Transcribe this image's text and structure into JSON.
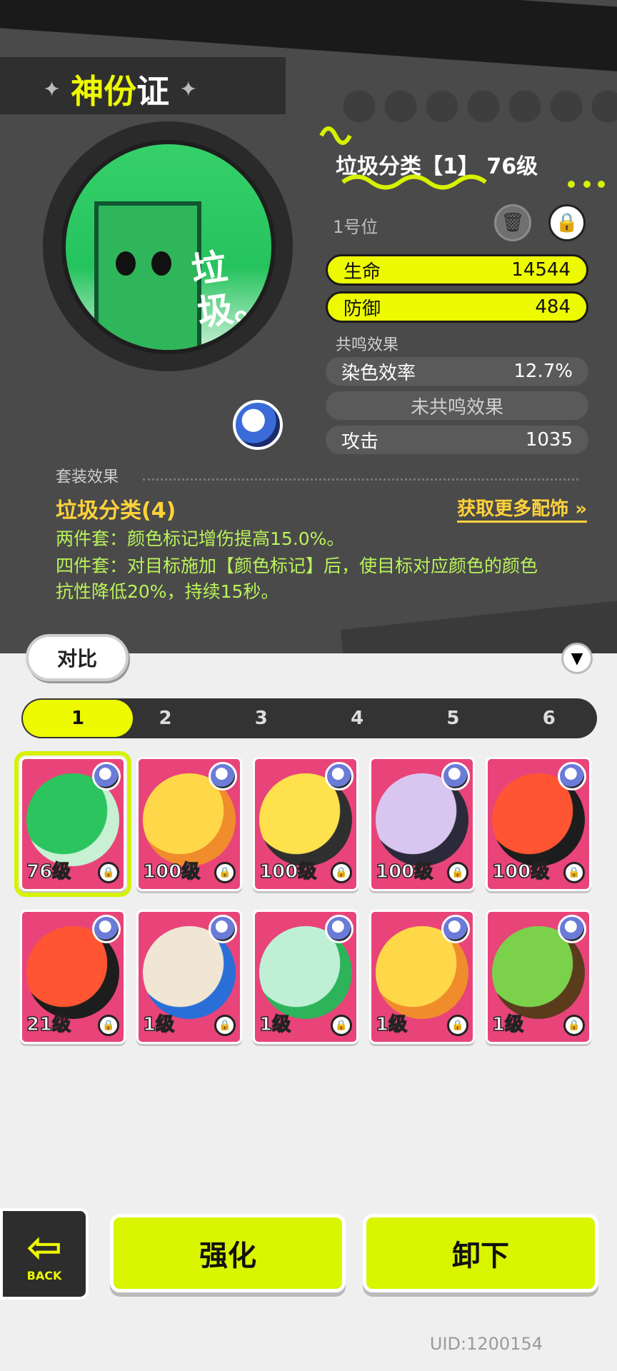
{
  "header": {
    "title_a": "神份",
    "title_b": "证"
  },
  "item": {
    "name": "垃圾分类【1】 76级",
    "slot": "1号位",
    "main_stats": [
      {
        "label": "生命",
        "value": "14544"
      },
      {
        "label": "防御",
        "value": "484"
      }
    ],
    "resonance_title": "共鸣效果",
    "sub_stats": [
      {
        "label": "染色效率",
        "value": "12.7%"
      },
      {
        "label": "未共鸣效果",
        "value": ""
      },
      {
        "label": "攻击",
        "value": "1035"
      }
    ],
    "emblem_text": "垃圾。"
  },
  "suit": {
    "label": "套装效果",
    "title": "垃圾分类(4)",
    "get_more": "获取更多配饰 »",
    "effect_2": "两件套：颜色标记增伤提高15.0%。",
    "effect_4_line1": "四件套：对目标施加【颜色标记】后，使目标对应颜色的颜色",
    "effect_4_line2": "抗性降低20%，持续15秒。"
  },
  "controls": {
    "compare": "对比",
    "tabs": [
      "1",
      "2",
      "3",
      "4",
      "5",
      "6"
    ],
    "active_tab": "1"
  },
  "cards": [
    {
      "level": "76级",
      "colors": [
        "#2bc45f",
        "#c8f0d3"
      ],
      "selected": true
    },
    {
      "level": "100级",
      "colors": [
        "#ffd84a",
        "#f08c2c"
      ]
    },
    {
      "level": "100级",
      "colors": [
        "#ffe14d",
        "#2f2f2f"
      ]
    },
    {
      "level": "100级",
      "colors": [
        "#d9c6f0",
        "#2a2a3a"
      ]
    },
    {
      "level": "100级",
      "colors": [
        "#ff5533",
        "#1d1d1d"
      ]
    },
    {
      "level": "21级",
      "colors": [
        "#ff5533",
        "#1d1d1d"
      ]
    },
    {
      "level": "1级",
      "colors": [
        "#f1e6d4",
        "#2a6fd8"
      ]
    },
    {
      "level": "1级",
      "colors": [
        "#bff0d6",
        "#2db35a"
      ]
    },
    {
      "level": "1级",
      "colors": [
        "#ffd84a",
        "#f08c2c"
      ]
    },
    {
      "level": "1级",
      "colors": [
        "#7bd14a",
        "#5a3b1c"
      ]
    }
  ],
  "bottom": {
    "back_label": "BACK",
    "enhance": "强化",
    "unequip": "卸下",
    "uid": "UID:1200154"
  },
  "colors": {
    "accent": "#eefb00",
    "card": "#e8447a",
    "gold": "#ffd23a",
    "effect": "#b9f35a"
  }
}
